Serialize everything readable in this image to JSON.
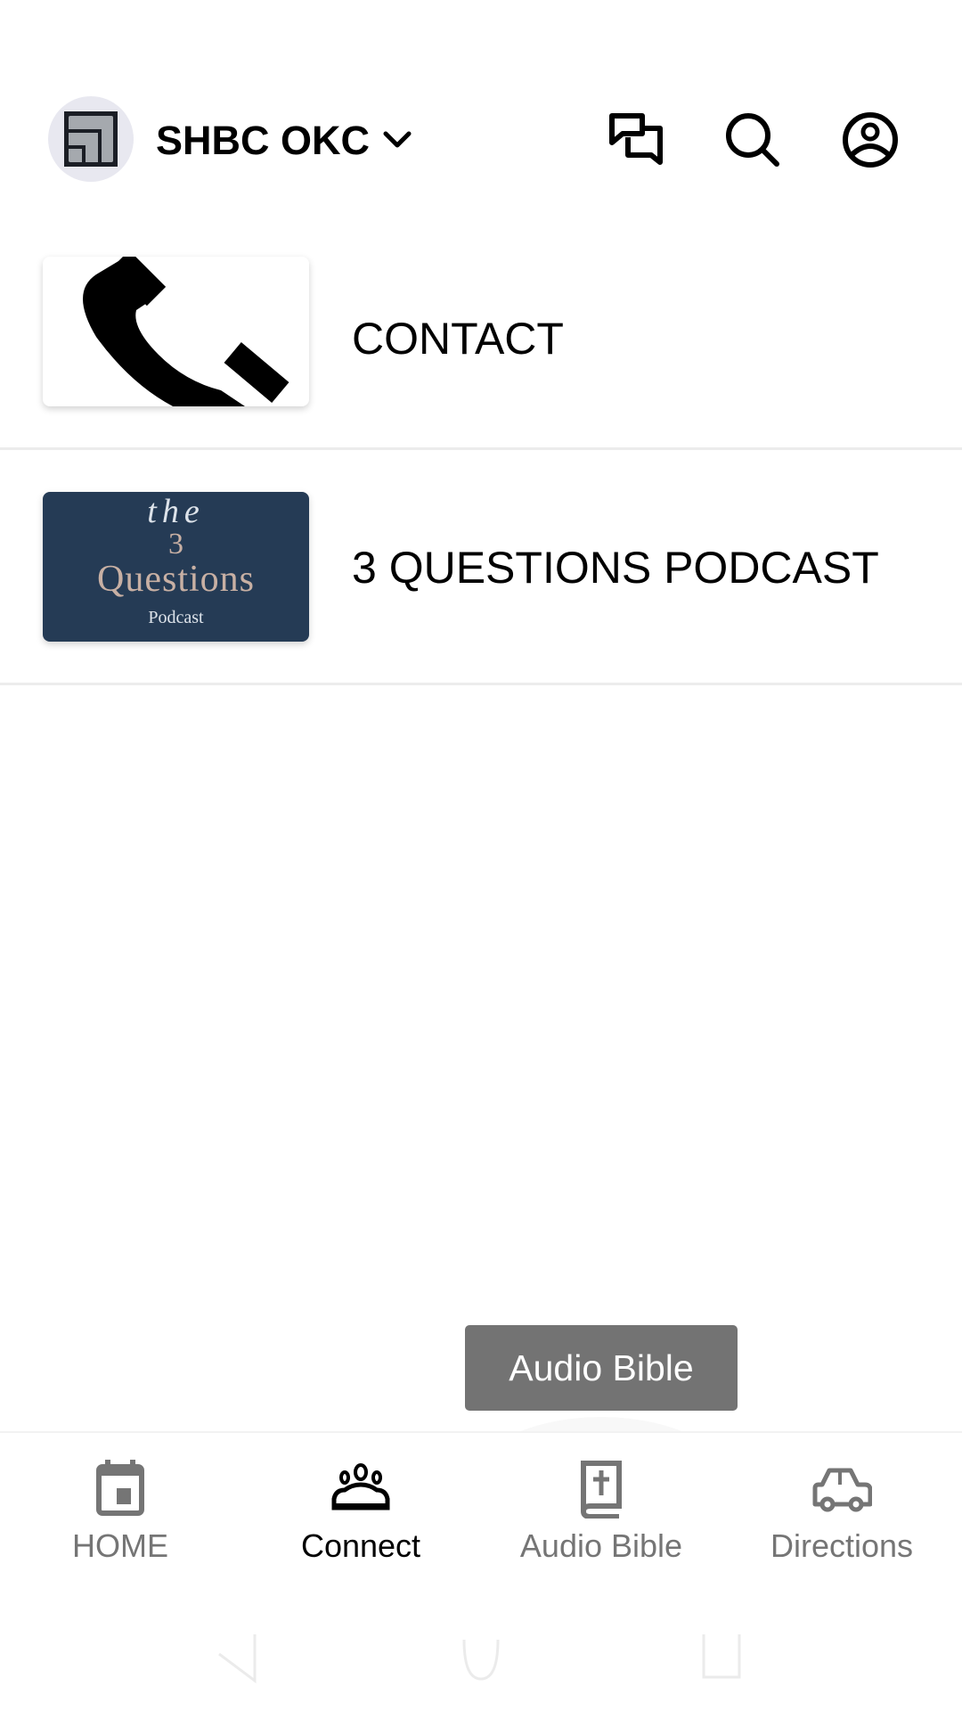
{
  "header": {
    "org_name": "SHBC OKC",
    "icons": [
      "chat-icon",
      "search-icon",
      "account-icon"
    ]
  },
  "list": [
    {
      "label": "CONTACT",
      "thumbnail": "phone-image"
    },
    {
      "label": "3 QUESTIONS PODCAST",
      "thumbnail": "podcast-cover",
      "cover": {
        "line1": "the",
        "line2": "3",
        "line3": "Questions",
        "line4": "Podcast"
      }
    }
  ],
  "tooltip": {
    "text": "Audio Bible"
  },
  "bottom_nav": {
    "active": "Connect",
    "items": [
      {
        "label": "HOME",
        "icon": "calendar-icon"
      },
      {
        "label": "Connect",
        "icon": "people-group-icon"
      },
      {
        "label": "Audio Bible",
        "icon": "bible-icon"
      },
      {
        "label": "Directions",
        "icon": "car-icon"
      }
    ]
  },
  "colors": {
    "podcast_bg": "#253b55",
    "podcast_accent": "#c8b0a4",
    "inactive": "#757575",
    "tooltip_bg": "#737373"
  }
}
